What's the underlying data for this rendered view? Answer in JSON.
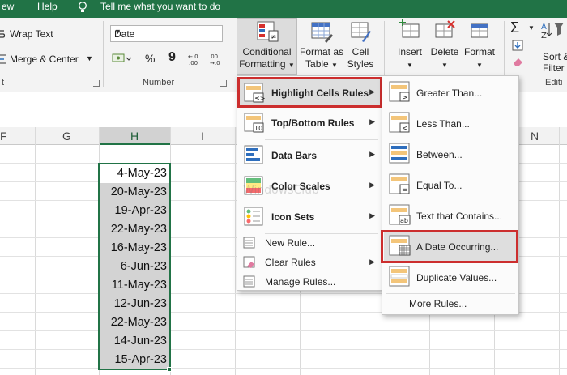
{
  "topbar": {
    "tab_view": "ew",
    "tab_help": "Help",
    "tell_me": "Tell me what you want to do"
  },
  "ribbon": {
    "wrap_text": "Wrap Text",
    "merge_center": "Merge & Center",
    "alignment_group_tail": "t",
    "number_format_value": "Date",
    "number_symbols": {
      "percent": "%",
      "comma": "9"
    },
    "number_group": "Number",
    "conditional_formatting": [
      "Conditional",
      "Formatting"
    ],
    "format_as_table": [
      "Format as",
      "Table"
    ],
    "cell_styles": [
      "Cell",
      "Styles"
    ],
    "insert": "Insert",
    "delete": "Delete",
    "format": "Format",
    "sort_filter": [
      "Sort &",
      "Filter"
    ],
    "editing_group": "Editi"
  },
  "grid": {
    "columns": [
      "F",
      "G",
      "H",
      "I",
      "N"
    ],
    "dates": [
      "4-May-23",
      "20-May-23",
      "19-Apr-23",
      "22-May-23",
      "16-May-23",
      "6-Jun-23",
      "11-May-23",
      "12-Jun-23",
      "22-May-23",
      "14-Jun-23",
      "15-Apr-23"
    ]
  },
  "cf_menu": {
    "highlight_cells_rules": "Highlight Cells Rules",
    "top_bottom_rules": "Top/Bottom Rules",
    "data_bars": "Data Bars",
    "color_scales": "Color Scales",
    "icon_sets": "Icon Sets",
    "new_rule": "New Rule...",
    "clear_rules": "Clear Rules",
    "manage_rules": "Manage Rules...",
    "icon_top10_text": "10"
  },
  "submenu": {
    "greater_than": "Greater Than...",
    "less_than": "Less Than...",
    "between": "Between...",
    "equal_to": "Equal To...",
    "text_contains": "Text that Contains...",
    "date_occurring": "A Date Occurring...",
    "duplicate_values": "Duplicate Values...",
    "more_rules": "More Rules..."
  },
  "watermark": "WindowsClub",
  "colors": {
    "excel_green": "#217346",
    "highlight_red": "#cc2e2e",
    "cell_selected": "#d3d3d3"
  }
}
